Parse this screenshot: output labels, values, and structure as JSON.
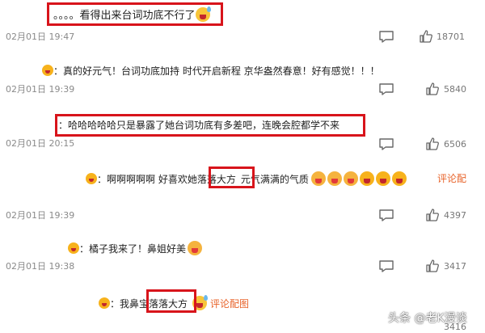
{
  "comments": [
    {
      "text": "。。。。看得出来台词功底不行了",
      "time": "02月01日 19:47",
      "likes": "18701"
    },
    {
      "prefix": "：",
      "text": "真的好元气！台词功底加持 时代开启新程 京华盎然春意！好有感觉！！！",
      "time": "02月01日 19:39",
      "likes": "5840"
    },
    {
      "prefix": "：",
      "text": "哈哈哈哈哈只是暴露了她台词功底有多差吧，连晚会腔都学不来",
      "time": "02月01日 20:15",
      "likes": "6506"
    },
    {
      "prefix": "：啊啊啊啊啊 好喜欢她",
      "highlight": "落落大方",
      "suffix": "元气满满的气质",
      "link": "评论配",
      "time": "02月01日 19:39",
      "likes": "4397"
    },
    {
      "prefix": "：橘子我来了！鼻姐好美",
      "time": "02月01日 19:38",
      "likes": "3417"
    },
    {
      "prefix": "：我鼻宝",
      "highlight": "落落大方",
      "link": "评论配图",
      "likes": "3416"
    }
  ],
  "watermark": {
    "platform": "头条",
    "author": "@老K漫谈"
  },
  "icons": {
    "comment": "comment-icon",
    "like": "thumbs-up-icon",
    "emoji": "emoji-icon"
  },
  "colors": {
    "highlight_border": "#d8141b",
    "link": "#e8642b",
    "meta": "#8a8a8a"
  }
}
